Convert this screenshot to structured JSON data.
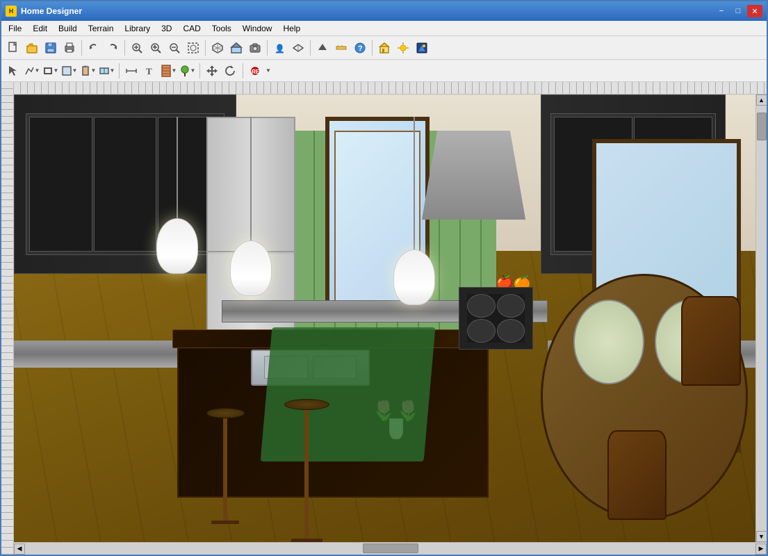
{
  "window": {
    "title": "Home Designer",
    "icon": "H"
  },
  "titlebar": {
    "minimize_label": "−",
    "maximize_label": "□",
    "close_label": "✕"
  },
  "menubar": {
    "items": [
      {
        "id": "file",
        "label": "File"
      },
      {
        "id": "edit",
        "label": "Edit"
      },
      {
        "id": "build",
        "label": "Build"
      },
      {
        "id": "terrain",
        "label": "Terrain"
      },
      {
        "id": "library",
        "label": "Library"
      },
      {
        "id": "3d",
        "label": "3D"
      },
      {
        "id": "cad",
        "label": "CAD"
      },
      {
        "id": "tools",
        "label": "Tools"
      },
      {
        "id": "window",
        "label": "Window"
      },
      {
        "id": "help",
        "label": "Help"
      }
    ]
  },
  "toolbar1": {
    "buttons": [
      "new",
      "open",
      "save",
      "print",
      "undo",
      "redo",
      "zoom-fit",
      "zoom-in",
      "zoom-out",
      "zoom-window",
      "sep1",
      "go-back",
      "go-forward",
      "sep2",
      "exterior",
      "interior",
      "floor-plan",
      "sep3",
      "camera",
      "walk",
      "fly",
      "sep4",
      "measure",
      "help-btn"
    ]
  },
  "toolbar2": {
    "buttons": [
      "select",
      "polyline",
      "wall",
      "room",
      "door",
      "window-tool",
      "sep1",
      "dimension",
      "text-tool",
      "material",
      "plant",
      "sep2",
      "move",
      "rotate",
      "sep3",
      "record"
    ]
  },
  "statusbar": {
    "text": ""
  }
}
